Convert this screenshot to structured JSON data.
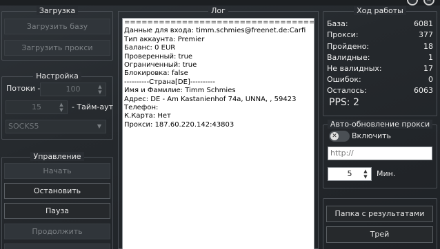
{
  "load": {
    "title": "Загрузка",
    "load_base": "Загрузить базу",
    "load_proxy": "Загрузить прокси"
  },
  "settings": {
    "title": "Настройка",
    "threads_label": "Потоки -",
    "threads_value": "100",
    "timeout_value": "15",
    "timeout_label": "- Тайм-аут",
    "proxy_type": "SOCKS5"
  },
  "control": {
    "title": "Управление",
    "start": "Начать",
    "stop": "Остановить",
    "pause": "Пауза",
    "resume": "Продолжить"
  },
  "log": {
    "title": "Лог",
    "lines": [
      "=========================================",
      "Данные для входа: timm.schmies@freenet.de:Carfi",
      "Тип аккаунта: Premier",
      "Баланс: 0 EUR",
      "Проверенный: true",
      "Ограниченный: true",
      "Блокировка: false",
      "----------Страна[DE]----------",
      "Имя и Фамилие: Timm Schmies",
      "Адрес: DE - Am Kastanienhof 74a, UNNA, , 59423",
      "Телефон:",
      "К.Карта: Нет",
      "Прокси: 187.60.220.142:43803"
    ]
  },
  "progress": {
    "title": "Ход работы",
    "rows": [
      {
        "label": "База:",
        "value": "6081"
      },
      {
        "label": "Прокси:",
        "value": "377"
      },
      {
        "label": "Пройдено:",
        "value": "18"
      },
      {
        "label": "Валидные:",
        "value": "1"
      },
      {
        "label": "Не валидных:",
        "value": "17"
      },
      {
        "label": "Ошибок:",
        "value": "0"
      },
      {
        "label": "Осталось:",
        "value": "6063"
      }
    ],
    "pps": "PPS: 2"
  },
  "autoupdate": {
    "title": "Авто-обновление прокси",
    "toggle_label": "Включить",
    "toggle_on": false,
    "url_placeholder": "http://",
    "minutes_value": "5",
    "minutes_label": "Мин."
  },
  "actions": {
    "results_folder": "Папка с результатами",
    "tray": "Трей"
  },
  "window": {
    "minimize_glyph": "−",
    "close_glyph": "×"
  }
}
